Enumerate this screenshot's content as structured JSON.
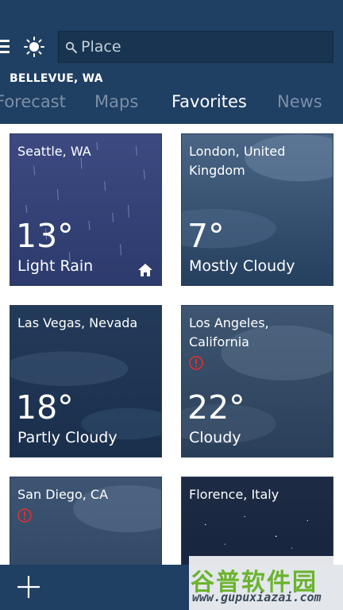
{
  "header": {
    "search": {
      "placeholder": "Place"
    },
    "location": "BELLEVUE, WA",
    "tabs": [
      {
        "label": "Forecast",
        "active": false
      },
      {
        "label": "Maps",
        "active": false
      },
      {
        "label": "Favorites",
        "active": true
      },
      {
        "label": "News",
        "active": false
      }
    ]
  },
  "favorites": [
    {
      "name": "Seattle, WA",
      "temp": "13°",
      "condition": "Light Rain",
      "home": true,
      "alert": false
    },
    {
      "name": "London, United Kingdom",
      "temp": "7°",
      "condition": "Mostly Cloudy",
      "home": false,
      "alert": false
    },
    {
      "name": "Las Vegas, Nevada",
      "temp": "18°",
      "condition": "Partly Cloudy",
      "home": false,
      "alert": false
    },
    {
      "name": "Los Angeles, California",
      "temp": "22°",
      "condition": "Cloudy",
      "home": false,
      "alert": true
    },
    {
      "name": "San Diego, CA",
      "temp": "",
      "condition": "",
      "home": false,
      "alert": true
    },
    {
      "name": "Florence, Italy",
      "temp": "",
      "condition": "",
      "home": false,
      "alert": false
    }
  ],
  "watermark": {
    "title": "谷普软件园",
    "url": "www.gupuxiazai.com"
  },
  "colors": {
    "header": "#1f3f63",
    "tab_inactive": "#7d8fa6",
    "alert": "#e0312b"
  },
  "icons": [
    "hamburger-menu-icon",
    "sun-icon",
    "search-icon",
    "home-icon",
    "alert-icon",
    "add-icon"
  ]
}
